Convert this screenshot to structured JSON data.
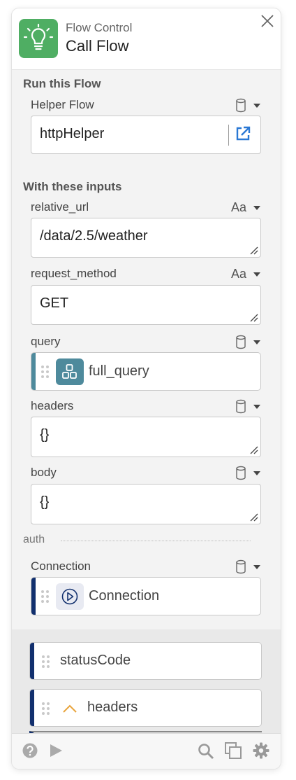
{
  "header": {
    "subtitle": "Flow Control",
    "title": "Call Flow",
    "icon": "lightbulb-icon",
    "accent": "#4fae63"
  },
  "run_section": {
    "title": "Run this Flow",
    "helper_flow": {
      "label": "Helper Flow",
      "value": "httpHelper",
      "type_icon": "database-icon"
    }
  },
  "inputs_section": {
    "title": "With these inputs",
    "fields": [
      {
        "label": "relative_url",
        "type": "Aa",
        "value": "/data/2.5/weather"
      },
      {
        "label": "request_method",
        "type": "Aa",
        "value": "GET"
      },
      {
        "label": "query",
        "type_icon": "database-icon",
        "value": "full_query",
        "value_icon": "object-icon"
      },
      {
        "label": "headers",
        "type_icon": "database-icon",
        "value": "{}"
      },
      {
        "label": "body",
        "type_icon": "database-icon",
        "value": "{}"
      }
    ]
  },
  "auth_section": {
    "title": "auth",
    "connection": {
      "label": "Connection",
      "type_icon": "database-icon",
      "value": "Connection",
      "value_icon": "play-circle-icon"
    }
  },
  "outputs": [
    {
      "label": "statusCode"
    },
    {
      "label": "headers",
      "icon": "chevron-up-icon"
    }
  ],
  "colors": {
    "variable_bar": "#4e8a9c",
    "output_bar": "#12306e",
    "panel_bg": "#f3f3f3",
    "link_blue": "#2a78d4"
  }
}
